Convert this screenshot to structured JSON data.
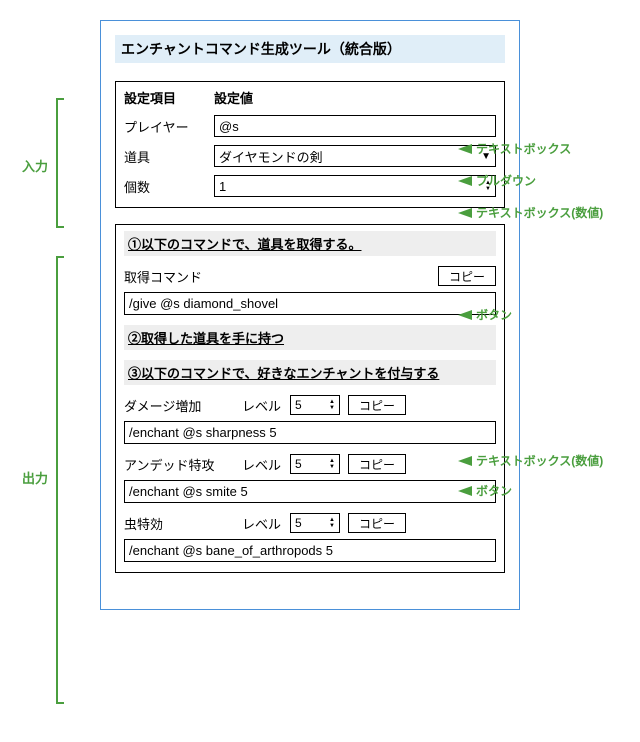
{
  "title": "エンチャントコマンド生成ツール（統合版）",
  "headers": {
    "col1": "設定項目",
    "col2": "設定値"
  },
  "input": {
    "player_label": "プレイヤー",
    "player_value": "@s",
    "tool_label": "道具",
    "tool_value": "ダイヤモンドの剣",
    "count_label": "個数",
    "count_value": "1"
  },
  "step1": {
    "header": "①以下のコマンドで、道具を取得する。",
    "label": "取得コマンド",
    "copy": "コピー",
    "output": "/give @s diamond_shovel"
  },
  "step2": {
    "header": "②取得した道具を手に持つ"
  },
  "step3": {
    "header": "③以下のコマンドで、好きなエンチャントを付与する",
    "level_label": "レベル",
    "copy": "コピー",
    "rows": [
      {
        "name": "ダメージ増加",
        "level": "5",
        "cmd": "/enchant @s sharpness 5"
      },
      {
        "name": "アンデッド特攻",
        "level": "5",
        "cmd": "/enchant @s smite 5"
      },
      {
        "name": "虫特効",
        "level": "5",
        "cmd": "/enchant @s bane_of_arthropods 5"
      }
    ]
  },
  "annot": {
    "in_label": "入力",
    "out_label": "出力",
    "textbox": "テキストボックス",
    "pulldown": "プルダウン",
    "num_textbox": "テキストボックス(数値)",
    "button": "ボタン"
  }
}
